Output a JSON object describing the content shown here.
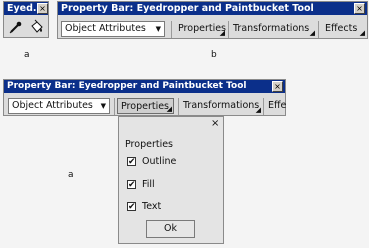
{
  "small_toolbar": {
    "title": "Eyed...",
    "close": "×",
    "tools": [
      {
        "icon": "eyedropper-icon"
      },
      {
        "icon": "paintbucket-icon"
      }
    ]
  },
  "toolbar_b": {
    "title": "Property Bar: Eyedropper and Paintbucket Tool",
    "close": "×",
    "select_value": "Object Attributes",
    "buttons": [
      "Properties",
      "Transformations",
      "Effects"
    ]
  },
  "toolbar_main": {
    "title": "Property Bar: Eyedropper and Paintbucket Tool",
    "close": "×",
    "select_value": "Object Attributes",
    "buttons": [
      "Properties",
      "Transformations",
      "Effects"
    ]
  },
  "popup": {
    "close": "×",
    "section_title": "Properties",
    "options": [
      {
        "label": "Outline",
        "checked": true
      },
      {
        "label": "Fill",
        "checked": true
      },
      {
        "label": "Text",
        "checked": true
      }
    ],
    "ok_label": "Ok"
  },
  "captions": {
    "a": "a",
    "b": "b",
    "a2": "a"
  }
}
